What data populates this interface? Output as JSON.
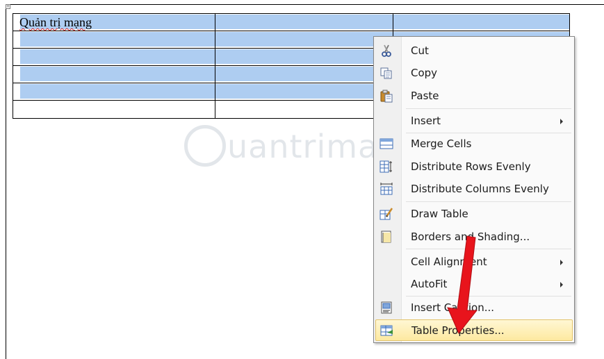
{
  "document": {
    "table": {
      "rows": [
        [
          "Quản trị mạng",
          "",
          ""
        ],
        [
          "",
          "",
          ""
        ],
        [
          "",
          "",
          ""
        ],
        [
          "",
          "",
          ""
        ],
        [
          "",
          "",
          ""
        ],
        [
          "",
          "",
          ""
        ]
      ]
    }
  },
  "context_menu": {
    "items": [
      {
        "label": "Cut",
        "icon": "scissors-icon"
      },
      {
        "label": "Copy",
        "icon": "copy-icon"
      },
      {
        "label": "Paste",
        "icon": "paste-icon"
      },
      {
        "label": "Insert",
        "icon": "",
        "submenu": true
      },
      {
        "label": "Merge Cells",
        "icon": "merge-cells-icon"
      },
      {
        "label": "Distribute Rows Evenly",
        "icon": "distribute-rows-icon"
      },
      {
        "label": "Distribute Columns Evenly",
        "icon": "distribute-columns-icon"
      },
      {
        "label": "Draw Table",
        "icon": "draw-table-icon"
      },
      {
        "label": "Borders and Shading...",
        "icon": "borders-shading-icon"
      },
      {
        "label": "Cell Alignment",
        "icon": "",
        "submenu": true
      },
      {
        "label": "AutoFit",
        "icon": "",
        "submenu": true
      },
      {
        "label": "Insert Caption...",
        "icon": "insert-caption-icon"
      },
      {
        "label": "Table Properties...",
        "icon": "table-properties-icon",
        "highlighted": true
      }
    ]
  },
  "watermark": {
    "text": "uantrimang"
  },
  "colors": {
    "selection": "#aecdf1",
    "menu_highlight": "#fde9a0",
    "annotation_arrow": "#e8141c"
  }
}
